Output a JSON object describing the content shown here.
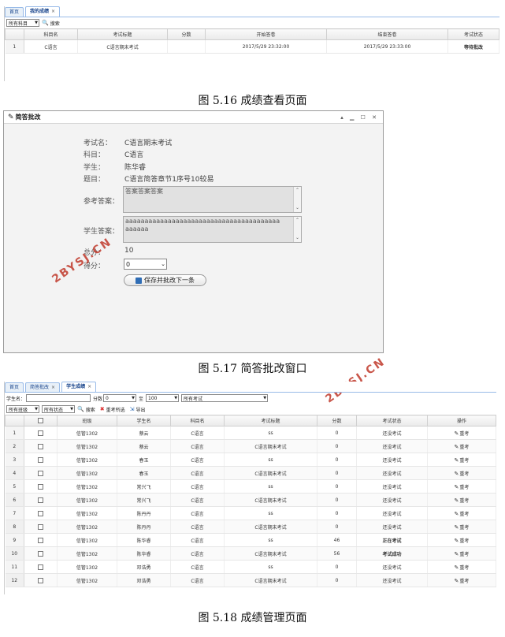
{
  "fig1": {
    "tabs": [
      {
        "label": "首页",
        "active": false
      },
      {
        "label": "我的成绩",
        "active": true,
        "closable": true
      }
    ],
    "subject_filter": "所有科目",
    "search_label": "搜索",
    "columns": [
      "",
      "科目名",
      "考试标题",
      "分数",
      "开始答卷",
      "结束答卷",
      "考试状态"
    ],
    "rows": [
      {
        "n": "1",
        "subject": "C语言",
        "title": "C语言期末考试",
        "score": "",
        "start": "2017/5/29 23:32:00",
        "end": "2017/5/29 23:33:00",
        "status": "等待批改"
      }
    ],
    "caption": "图 5.16 成绩查看页面"
  },
  "fig2": {
    "window_title": "简答批改",
    "controls": "▴ ▁ ☐ ✕",
    "fields": {
      "exam_label": "考试名：",
      "exam": "C语言期末考试",
      "subject_label": "科目：",
      "subject": "C语言",
      "student_label": "学生：",
      "student": "陈华睿",
      "question_label": "题目：",
      "question": "C语言简答章节1序号10较易",
      "reference_label": "参考答案：",
      "reference": "答案答案答案",
      "student_answer_label": "学生答案：",
      "student_answer": "aaaaaaaaaaaaaaaaaaaaaaaaaaaaaaaaaaaaaaaaaaaaaa",
      "total_label": "总分：",
      "total": "10",
      "score_label": "得分：",
      "score": "0"
    },
    "save_button": "保存并批改下一条",
    "caption": "图 5.17 简答批改窗口"
  },
  "fig3": {
    "tabs": [
      {
        "label": "首页",
        "active": false
      },
      {
        "label": "简答批改",
        "active": false,
        "closable": true
      },
      {
        "label": "学生成绩",
        "active": true,
        "closable": true
      }
    ],
    "student_name_label": "学生名：",
    "score_label": "分数",
    "score_from": "0",
    "to_label": "至",
    "score_to": "100",
    "exam_filter": "所有考试",
    "class_filter": "所有班级",
    "status_filter": "所有状态",
    "search_label": "搜索",
    "retake_selected_label": "重考所选",
    "export_label": "导出",
    "columns": [
      "",
      "",
      "班级",
      "学生名",
      "科目名",
      "考试标题",
      "分数",
      "考试状态",
      "操作"
    ],
    "retake_label": "重考",
    "rows": [
      {
        "n": "1",
        "cls": "信管1302",
        "name": "蔡云",
        "subject": "C语言",
        "title": "ss",
        "score": "0",
        "status": "还没考试",
        "st": ""
      },
      {
        "n": "2",
        "cls": "信管1302",
        "name": "蔡云",
        "subject": "C语言",
        "title": "C语言期末考试",
        "score": "0",
        "status": "还没考试",
        "st": ""
      },
      {
        "n": "3",
        "cls": "信管1302",
        "name": "春玉",
        "subject": "C语言",
        "title": "ss",
        "score": "0",
        "status": "还没考试",
        "st": ""
      },
      {
        "n": "4",
        "cls": "信管1302",
        "name": "春玉",
        "subject": "C语言",
        "title": "C语言期末考试",
        "score": "0",
        "status": "还没考试",
        "st": ""
      },
      {
        "n": "5",
        "cls": "信管1302",
        "name": "常兴飞",
        "subject": "C语言",
        "title": "ss",
        "score": "0",
        "status": "还没考试",
        "st": ""
      },
      {
        "n": "6",
        "cls": "信管1302",
        "name": "常兴飞",
        "subject": "C语言",
        "title": "C语言期末考试",
        "score": "0",
        "status": "还没考试",
        "st": ""
      },
      {
        "n": "7",
        "cls": "信管1302",
        "name": "陈丹丹",
        "subject": "C语言",
        "title": "ss",
        "score": "0",
        "status": "还没考试",
        "st": ""
      },
      {
        "n": "8",
        "cls": "信管1302",
        "name": "陈丹丹",
        "subject": "C语言",
        "title": "C语言期末考试",
        "score": "0",
        "status": "还没考试",
        "st": ""
      },
      {
        "n": "9",
        "cls": "信管1302",
        "name": "陈华睿",
        "subject": "C语言",
        "title": "ss",
        "score": "46",
        "status": "正在考试",
        "st": "bold"
      },
      {
        "n": "10",
        "cls": "信管1302",
        "name": "陈华睿",
        "subject": "C语言",
        "title": "C语言期末考试",
        "score": "56",
        "status": "考试成功",
        "st": "ok"
      },
      {
        "n": "11",
        "cls": "信管1302",
        "name": "邓浩勇",
        "subject": "C语言",
        "title": "ss",
        "score": "0",
        "status": "还没考试",
        "st": ""
      },
      {
        "n": "12",
        "cls": "信管1302",
        "name": "邓浩勇",
        "subject": "C语言",
        "title": "C语言期末考试",
        "score": "0",
        "status": "还没考试",
        "st": ""
      }
    ],
    "caption": "图 5.18 成绩管理页面"
  },
  "watermarks": [
    "2BYSJ.CN",
    "2BYSJ.CN"
  ],
  "colors": {
    "status_ok": "#2a9a2a",
    "tab_border": "#99bbe8",
    "watermark": "#c0392b"
  }
}
